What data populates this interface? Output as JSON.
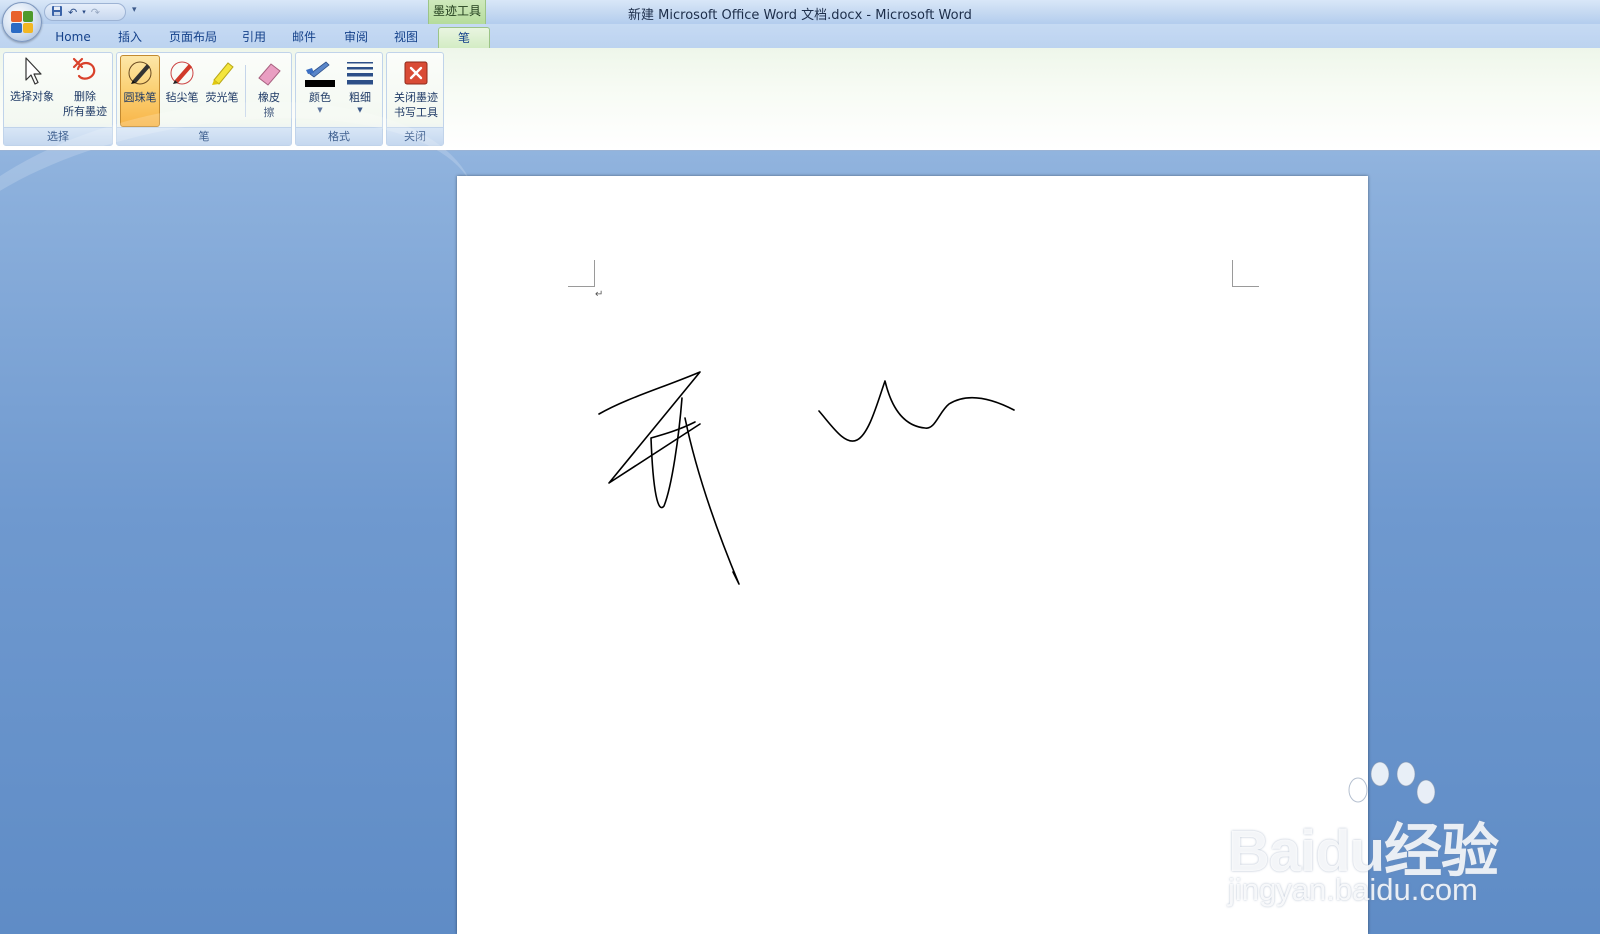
{
  "window": {
    "title": "新建 Microsoft Office Word 文档.docx - Microsoft Word",
    "contextual_tab_group": "墨迹工具"
  },
  "quick_access": {
    "items": [
      "save-icon",
      "undo-icon",
      "redo-icon",
      "customize-icon"
    ]
  },
  "tabs": [
    {
      "label": "Home"
    },
    {
      "label": "插入"
    },
    {
      "label": "页面布局"
    },
    {
      "label": "引用"
    },
    {
      "label": "邮件"
    },
    {
      "label": "审阅"
    },
    {
      "label": "视图"
    },
    {
      "label": "笔",
      "active": true
    }
  ],
  "ribbon": {
    "groups": [
      {
        "label": "选择",
        "buttons": [
          {
            "label_line1": "选择对象",
            "label_line2": "",
            "icon": "cursor-arrow-icon"
          },
          {
            "label_line1": "删除",
            "label_line2": "所有墨迹",
            "icon": "delete-ink-icon"
          }
        ]
      },
      {
        "label": "笔",
        "buttons": [
          {
            "label_line1": "圆珠笔",
            "icon": "ballpoint-pen-icon",
            "active": true
          },
          {
            "label_line1": "毡尖笔",
            "icon": "felt-tip-pen-icon"
          },
          {
            "label_line1": "荧光笔",
            "icon": "highlighter-icon"
          },
          {
            "label_line1": "橡皮",
            "label_line2": "擦",
            "icon": "eraser-icon"
          }
        ]
      },
      {
        "label": "格式",
        "buttons": [
          {
            "label_line1": "颜色",
            "icon": "pen-color-icon"
          },
          {
            "label_line1": "粗细",
            "icon": "line-thickness-icon"
          }
        ]
      },
      {
        "label": "关闭",
        "buttons": [
          {
            "label_line1": "关闭墨迹",
            "label_line2": "书写工具",
            "icon": "close-ink-tools-icon"
          }
        ]
      }
    ]
  },
  "document": {
    "paragraph_mark": "↵"
  },
  "watermark": {
    "brand": "Baidu经验",
    "url": "jingyan.baidu.com"
  },
  "colors": {
    "accent": "#15428b",
    "context_tab": "#b5dc9b",
    "active_button": "#fbd277",
    "ink": "#000000"
  }
}
